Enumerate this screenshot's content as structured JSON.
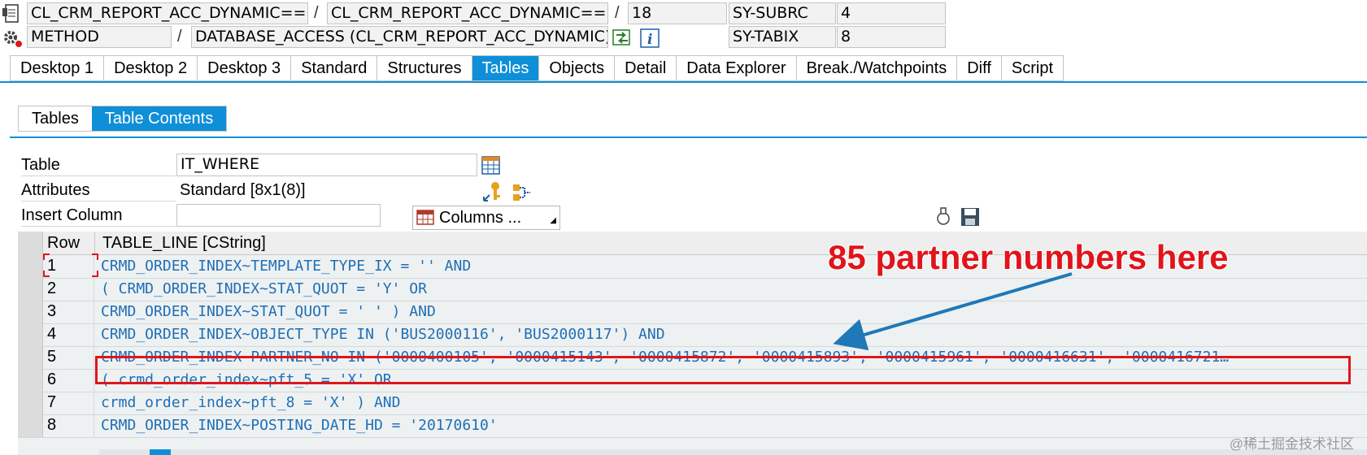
{
  "header": {
    "row1": {
      "field1": "CL_CRM_REPORT_ACC_DYNAMIC====...",
      "sep1": "/",
      "field2": "CL_CRM_REPORT_ACC_DYNAMIC====...",
      "sep2": "/",
      "field3": "18",
      "sysvar_name": "SY-SUBRC",
      "sysvar_value": "4"
    },
    "row2": {
      "field1": "METHOD",
      "sep1": "/",
      "field2": "DATABASE_ACCESS (CL_CRM_REPORT_ACC_DYNAMIC)",
      "sysvar_name": "SY-TABIX",
      "sysvar_value": "8"
    }
  },
  "tabs": [
    {
      "label": "Desktop 1"
    },
    {
      "label": "Desktop 2"
    },
    {
      "label": "Desktop 3"
    },
    {
      "label": "Standard"
    },
    {
      "label": "Structures"
    },
    {
      "label": "Tables",
      "active": true
    },
    {
      "label": "Objects"
    },
    {
      "label": "Detail"
    },
    {
      "label": "Data Explorer"
    },
    {
      "label": "Break./Watchpoints"
    },
    {
      "label": "Diff"
    },
    {
      "label": "Script"
    }
  ],
  "subtabs": [
    {
      "label": "Tables"
    },
    {
      "label": "Table Contents",
      "active": true
    }
  ],
  "form": {
    "table_label": "Table",
    "table_value": "IT_WHERE",
    "attributes_label": "Attributes",
    "attributes_value": "Standard [8x1(8)]",
    "insert_column_label": "Insert Column",
    "insert_column_value": "",
    "columns_button": "Columns ..."
  },
  "grid": {
    "headers": [
      "Row",
      "TABLE_LINE [CString]"
    ],
    "rows": [
      {
        "row": "1",
        "line": "CRMD_ORDER_INDEX~TEMPLATE_TYPE_IX = '' AND"
      },
      {
        "row": "2",
        "line": "( CRMD_ORDER_INDEX~STAT_QUOT = 'Y' OR"
      },
      {
        "row": "3",
        "line": "CRMD_ORDER_INDEX~STAT_QUOT = ' ' ) AND"
      },
      {
        "row": "4",
        "line": "CRMD_ORDER_INDEX~OBJECT_TYPE IN ('BUS2000116', 'BUS2000117') AND"
      },
      {
        "row": "5",
        "line": "CRMD_ORDER_INDEX~PARTNER_NO IN ('0000400105', '0000415143', '0000415872', '0000415893', '0000415961', '0000416631', '0000416721…"
      },
      {
        "row": "6",
        "line": "( crmd_order_index~pft_5  = 'X' OR"
      },
      {
        "row": "7",
        "line": "crmd_order_index~pft_8  = 'X' ) AND"
      },
      {
        "row": "8",
        "line": "CRMD_ORDER_INDEX~POSTING_DATE_HD = '20170610'"
      }
    ]
  },
  "annotation": {
    "text": "85 partner numbers here",
    "color": "#e0151c"
  },
  "watermark": "@稀土掘金技术社区",
  "colors": {
    "accent": "#0f8fd8",
    "code_text": "#1f6fb5",
    "highlight": "#e0151c"
  }
}
